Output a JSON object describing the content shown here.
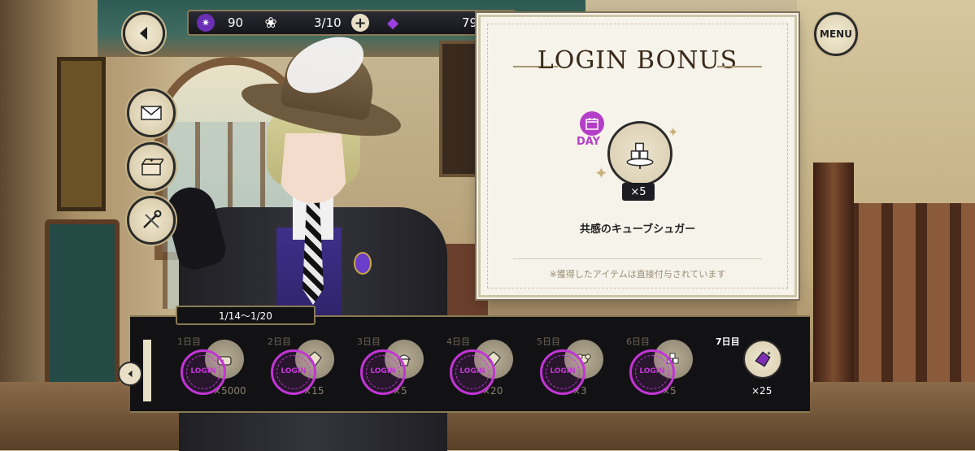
{
  "top_bar": {
    "gems": "90",
    "stamina": "3/10",
    "stones": "79"
  },
  "menu": {
    "label": "MENU"
  },
  "panel": {
    "title": "LOGIN BONUS",
    "day_label": "DAY",
    "reward_qty": "×5",
    "reward_name": "共感のキューブシュガー",
    "note": "※獲得したアイテムは直接付与されています"
  },
  "week": {
    "range": "1/14〜1/20",
    "days": [
      {
        "label": "1日目",
        "qty": "×5000",
        "claimed": true,
        "icon": "coin-bag-icon"
      },
      {
        "label": "2日目",
        "qty": "×15",
        "claimed": true,
        "icon": "gem-icon"
      },
      {
        "label": "3日目",
        "qty": "×5",
        "claimed": true,
        "icon": "cupcake-icon"
      },
      {
        "label": "4日目",
        "qty": "×20",
        "claimed": true,
        "icon": "gem-icon"
      },
      {
        "label": "5日目",
        "qty": "×3",
        "claimed": true,
        "icon": "flower-icon"
      },
      {
        "label": "6日目",
        "qty": "×5",
        "claimed": true,
        "icon": "sugar-cube-icon"
      },
      {
        "label": "7日目",
        "qty": "×25",
        "claimed": false,
        "icon": "purple-gem-icon"
      }
    ],
    "stamp_text": "LOGIN"
  },
  "colors": {
    "accent": "#b53ec8",
    "stamp": "#c335d6",
    "dark": "#121214",
    "gold": "#8a7a55"
  }
}
